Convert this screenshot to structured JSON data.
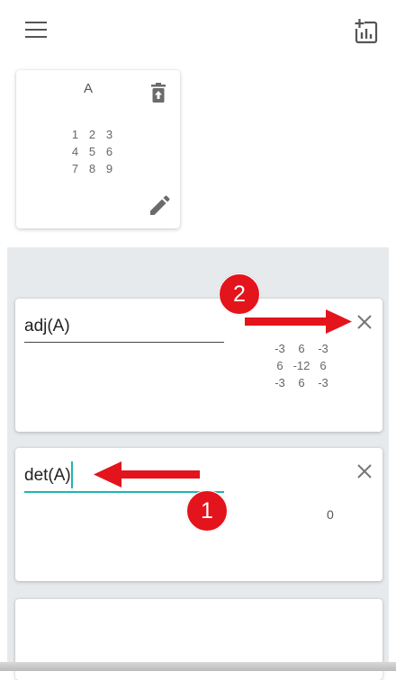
{
  "toolbar": {
    "menu_icon": "hamburger-menu-icon",
    "chart_icon": "add-chart-icon"
  },
  "matrix_card": {
    "name": "A",
    "rows": [
      [
        "1",
        "2",
        "3"
      ],
      [
        "4",
        "5",
        "6"
      ],
      [
        "7",
        "8",
        "9"
      ]
    ],
    "delete_icon": "trash-icon",
    "edit_icon": "pencil-icon"
  },
  "expressions": [
    {
      "input": "adj(A)",
      "result_matrix": [
        [
          "-3",
          "6",
          "-3"
        ],
        [
          "6",
          "-12",
          "6"
        ],
        [
          "-3",
          "6",
          "-3"
        ]
      ]
    },
    {
      "input": "det(A)",
      "result": "0"
    }
  ],
  "annotations": {
    "step1": "1",
    "step2": "2",
    "arrow_color": "#e3141b"
  },
  "colors": {
    "accent": "#1fb6b3",
    "background_band": "#e7eaed",
    "annotation_red": "#e3141b"
  }
}
